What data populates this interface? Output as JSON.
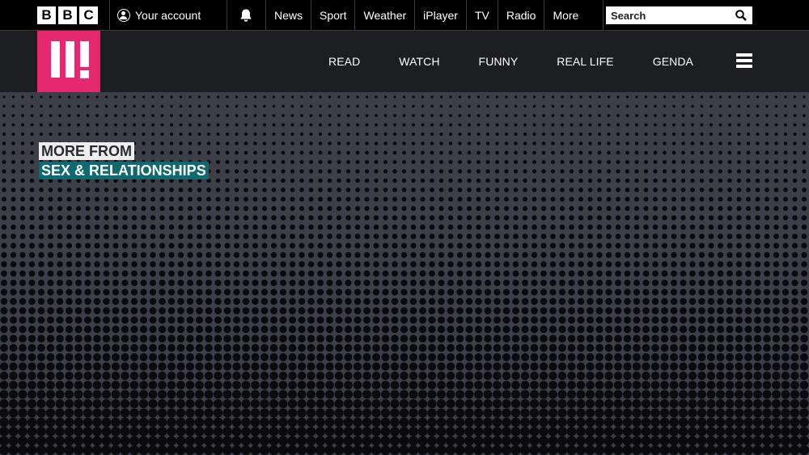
{
  "bbc": {
    "logo_letters": [
      "B",
      "B",
      "C"
    ]
  },
  "account": {
    "label": "Your account"
  },
  "topnav": [
    "News",
    "Sport",
    "Weather",
    "iPlayer",
    "TV",
    "Radio",
    "More"
  ],
  "search": {
    "placeholder": "Search"
  },
  "three_nav": [
    "READ",
    "WATCH",
    "FUNNY",
    "REAL LIFE",
    "GENDA"
  ],
  "hero": {
    "line1": "MORE FROM",
    "line2": "SEX & RELATIONSHIPS"
  },
  "colors": {
    "brand_pink": "#e6286e",
    "teal_label": "#0e6a70",
    "hero_bg": "#3c3e48",
    "three_bar_bg": "#1d1e22"
  }
}
